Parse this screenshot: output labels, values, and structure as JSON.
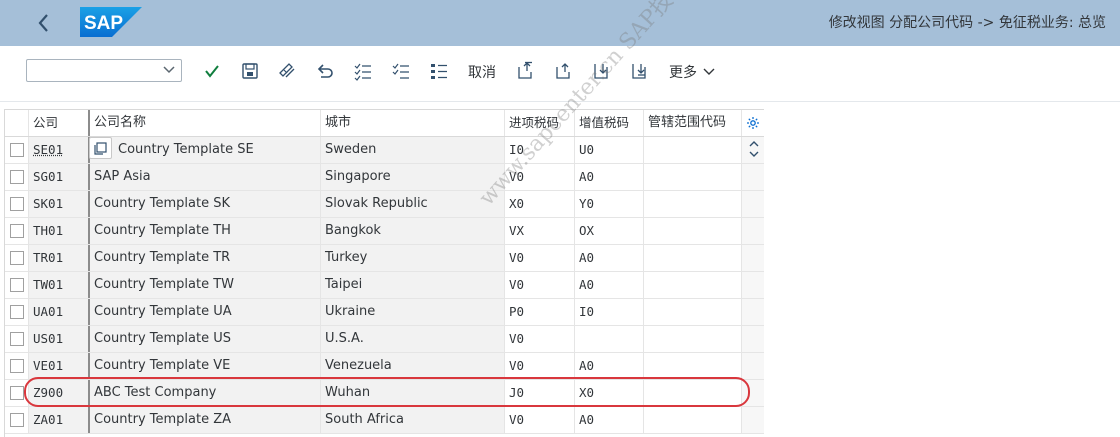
{
  "shell": {
    "title": "修改视图 分配公司代码 -> 免征税业务: 总览",
    "logo_text": "SAP",
    "back_icon": "chevron-left-icon"
  },
  "toolbar": {
    "dropdown_value": "",
    "cancel_label": "取消",
    "more_label": "更多",
    "accent_check": "#107e3e"
  },
  "table": {
    "columns": [
      "公司",
      "公司名称",
      "城市",
      "进项税码",
      "增值税码",
      "管辖范围代码"
    ],
    "rows": [
      {
        "code": "SE01",
        "name": "Country Template SE",
        "city": "Sweden",
        "input_tax": "I0",
        "vat": "U0",
        "jurisdiction": ""
      },
      {
        "code": "SG01",
        "name": "SAP Asia",
        "city": "Singapore",
        "input_tax": "V0",
        "vat": "A0",
        "jurisdiction": ""
      },
      {
        "code": "SK01",
        "name": "Country Template SK",
        "city": "Slovak Republic",
        "input_tax": "X0",
        "vat": "Y0",
        "jurisdiction": ""
      },
      {
        "code": "TH01",
        "name": "Country Template TH",
        "city": "Bangkok",
        "input_tax": "VX",
        "vat": "OX",
        "jurisdiction": ""
      },
      {
        "code": "TR01",
        "name": "Country Template TR",
        "city": "Turkey",
        "input_tax": "V0",
        "vat": "A0",
        "jurisdiction": ""
      },
      {
        "code": "TW01",
        "name": "Country Template TW",
        "city": "Taipei",
        "input_tax": "V0",
        "vat": "A0",
        "jurisdiction": ""
      },
      {
        "code": "UA01",
        "name": "Country Template UA",
        "city": "Ukraine",
        "input_tax": "P0",
        "vat": "I0",
        "jurisdiction": ""
      },
      {
        "code": "US01",
        "name": "Country Template US",
        "city": "U.S.A.",
        "input_tax": "V0",
        "vat": "",
        "jurisdiction": ""
      },
      {
        "code": "VE01",
        "name": "Country Template VE",
        "city": "Venezuela",
        "input_tax": "V0",
        "vat": "A0",
        "jurisdiction": ""
      },
      {
        "code": "Z900",
        "name": "ABC Test Company",
        "city": "Wuhan",
        "input_tax": "J0",
        "vat": "X0",
        "jurisdiction": ""
      },
      {
        "code": "ZA01",
        "name": "Country Template ZA",
        "city": "South Africa",
        "input_tax": "V0",
        "vat": "A0",
        "jurisdiction": ""
      }
    ],
    "highlight_color": "#d9373d"
  },
  "watermark": "www.sapcenter.cn SAP技术站"
}
